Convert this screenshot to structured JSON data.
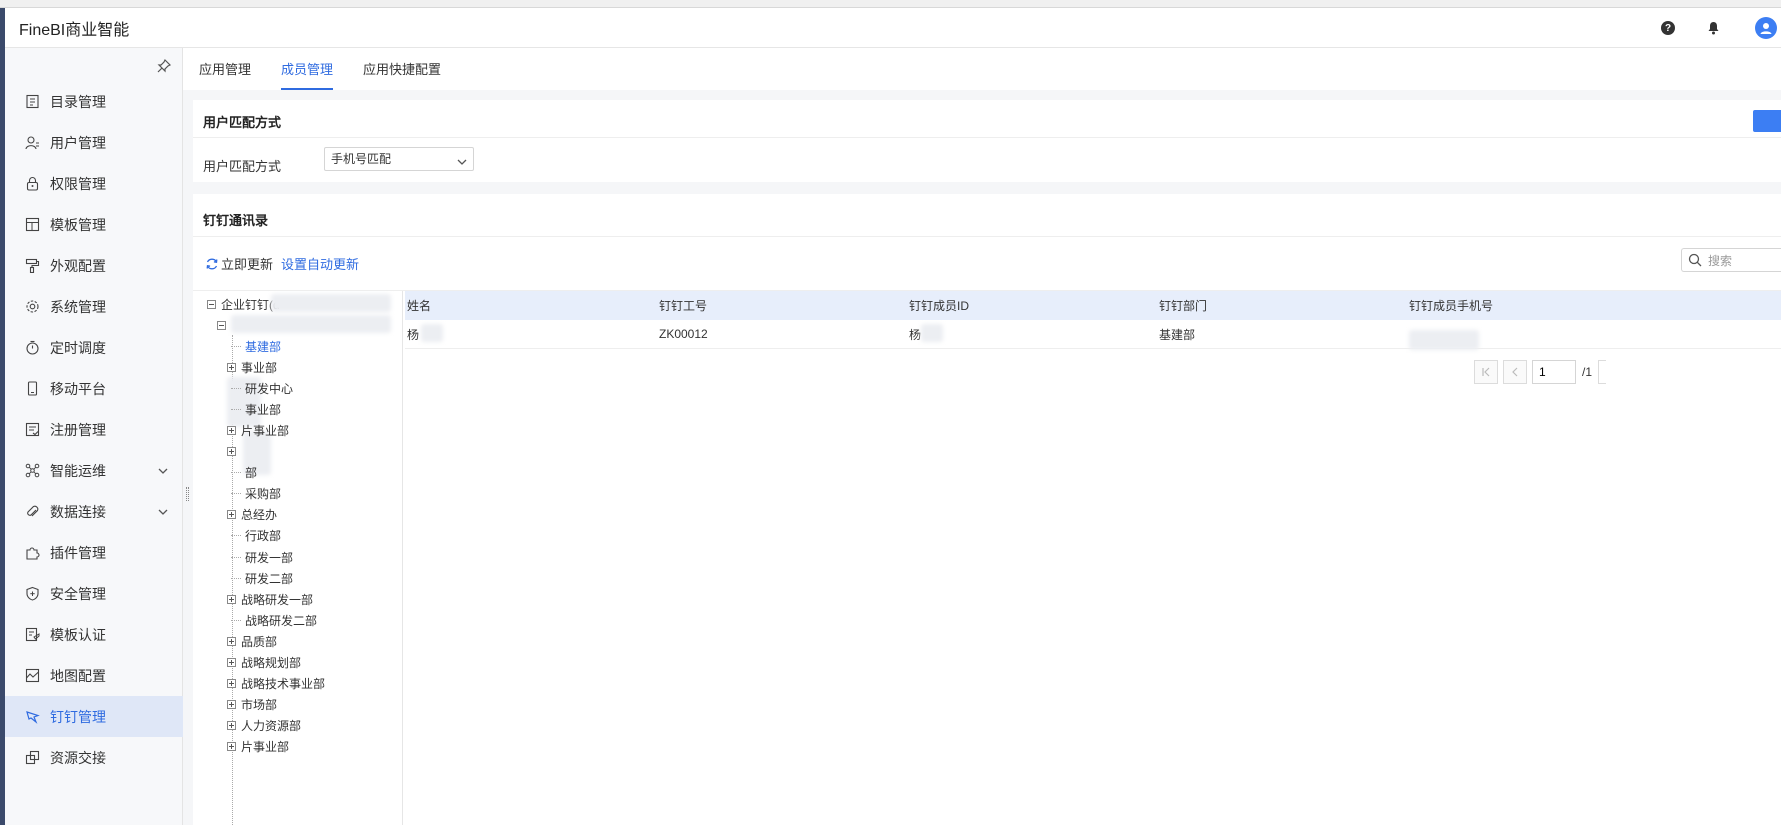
{
  "app": {
    "title": "FineBI商业智能",
    "help_icon_glyph": "?"
  },
  "colors": {
    "accent": "#2f6be0",
    "active_bg": "#dfe7f7",
    "header_row_bg": "#e7eefb",
    "avatar": "#3c7ef3"
  },
  "sidebar": {
    "items": [
      {
        "label": "目录管理",
        "icon": "catalog-icon"
      },
      {
        "label": "用户管理",
        "icon": "user-icon"
      },
      {
        "label": "权限管理",
        "icon": "lock-icon"
      },
      {
        "label": "模板管理",
        "icon": "template-icon"
      },
      {
        "label": "外观配置",
        "icon": "paint-roller-icon"
      },
      {
        "label": "系统管理",
        "icon": "gear-icon"
      },
      {
        "label": "定时调度",
        "icon": "stopwatch-icon"
      },
      {
        "label": "移动平台",
        "icon": "mobile-icon"
      },
      {
        "label": "注册管理",
        "icon": "register-icon"
      },
      {
        "label": "智能运维",
        "icon": "network-icon",
        "expandable": true
      },
      {
        "label": "数据连接",
        "icon": "paperclip-icon",
        "expandable": true
      },
      {
        "label": "插件管理",
        "icon": "puzzle-icon"
      },
      {
        "label": "安全管理",
        "icon": "shield-icon"
      },
      {
        "label": "模板认证",
        "icon": "certificate-icon"
      },
      {
        "label": "地图配置",
        "icon": "map-icon"
      },
      {
        "label": "钉钉管理",
        "icon": "dingtalk-icon",
        "active": true
      },
      {
        "label": "资源交接",
        "icon": "handover-icon"
      }
    ]
  },
  "tabs": [
    {
      "label": "应用管理"
    },
    {
      "label": "成员管理",
      "active": true
    },
    {
      "label": "应用快捷配置"
    }
  ],
  "match": {
    "section_title": "用户匹配方式",
    "field_label": "用户匹配方式",
    "selected_value": "手机号匹配"
  },
  "contacts": {
    "section_title": "钉钉通讯录",
    "refresh_label": "立即更新",
    "auto_update_label": "设置自动更新",
    "search_placeholder": "搜索"
  },
  "tree": {
    "root_label": "企业钉钉(d",
    "nodes": [
      {
        "label": "基建部",
        "selected": true,
        "toggle": ""
      },
      {
        "label": "事业部",
        "toggle": "plus"
      },
      {
        "label": "研发中心",
        "toggle": ""
      },
      {
        "label": "事业部",
        "toggle": ""
      },
      {
        "label": "片事业部",
        "toggle": "plus"
      },
      {
        "label": "",
        "toggle": "plus"
      },
      {
        "label": "部",
        "toggle": ""
      },
      {
        "label": "采购部",
        "toggle": ""
      },
      {
        "label": "总经办",
        "toggle": "plus"
      },
      {
        "label": "行政部",
        "toggle": ""
      },
      {
        "label": "研发一部",
        "toggle": ""
      },
      {
        "label": "研发二部",
        "toggle": ""
      },
      {
        "label": "战略研发一部",
        "toggle": "plus"
      },
      {
        "label": "战略研发二部",
        "toggle": ""
      },
      {
        "label": "品质部",
        "toggle": "plus"
      },
      {
        "label": "战略规划部",
        "toggle": "plus"
      },
      {
        "label": "战略技术事业部",
        "toggle": "plus"
      },
      {
        "label": "市场部",
        "toggle": "plus"
      },
      {
        "label": "人力资源部",
        "toggle": "plus"
      },
      {
        "label": "片事业部",
        "toggle": "plus"
      }
    ]
  },
  "table": {
    "columns": [
      "姓名",
      "钉钉工号",
      "钉钉成员ID",
      "钉钉部门",
      "钉钉成员手机号"
    ],
    "rows": [
      [
        "杨",
        "ZK00012",
        "杨",
        "基建部",
        ""
      ]
    ]
  },
  "pager": {
    "current": "1",
    "total": "/1"
  }
}
